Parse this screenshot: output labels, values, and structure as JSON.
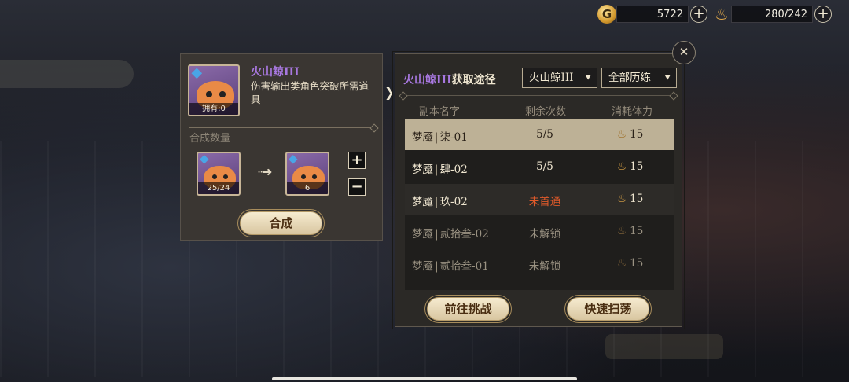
{
  "currency": {
    "gold": "5722",
    "stamina": "280/242"
  },
  "item": {
    "name": "火山鲸III",
    "description": "伤害输出类角色突破所需道具",
    "owned": "拥有:0",
    "quantity_label": "合成数量",
    "source_count": "25/24",
    "target_count": "6",
    "craft_label": "合成"
  },
  "acquire": {
    "title_name": "火山鲸III",
    "title_rest": "获取途径",
    "filter_item": "火山鲸III",
    "filter_mode": "全部历练",
    "headers": [
      "副本名字",
      "剩余次数",
      "消耗体力"
    ],
    "rows": [
      {
        "prefix": "梦魇",
        "stage": "柒-01",
        "remaining": "5/5",
        "cost": "15"
      },
      {
        "prefix": "梦魇",
        "stage": "肆-02",
        "remaining": "5/5",
        "cost": "15"
      },
      {
        "prefix": "梦魇",
        "stage": "玖-02",
        "remaining": "未首通",
        "cost": "15"
      },
      {
        "prefix": "梦魇",
        "stage": "贰拾叁-02",
        "remaining": "未解锁",
        "cost": "15"
      },
      {
        "prefix": "梦魇",
        "stage": "贰拾叁-01",
        "remaining": "未解锁",
        "cost": "15"
      }
    ],
    "go_label": "前往挑战",
    "sweep_label": "快速扫荡"
  },
  "icons": {
    "close": "close-icon",
    "plus": "plus-icon",
    "minus": "minus-icon",
    "stamina": "stamina-icon",
    "gold": "gold-coin-icon"
  },
  "colors": {
    "item_name": "#a878e0",
    "not_cleared": "#e05a2a",
    "selected_row": "#bdb196"
  }
}
